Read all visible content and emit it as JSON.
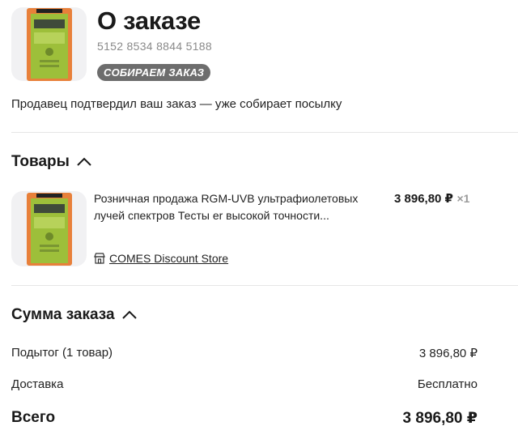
{
  "header": {
    "title": "О заказе",
    "order_number": "5152 8534 8844 5188",
    "status_badge": "СОБИРАЕМ ЗАКАЗ",
    "status_message": "Продавец подтвердил ваш заказ — уже собирает посылку"
  },
  "items_section": {
    "title": "Товары",
    "item": {
      "name_line1": "Розничная продажа RGM-UVB ультрафиолетовых",
      "name_line2": "лучей спектров Тесты er высокой точности...",
      "price": "3 896,80 ₽",
      "quantity": "×1",
      "store": "COMES Discount Store",
      "store_icon": "store-icon"
    }
  },
  "summary_section": {
    "title": "Сумма заказа",
    "subtotal_label": "Подытог (1 товар)",
    "subtotal_value": "3 896,80 ₽",
    "delivery_label": "Доставка",
    "delivery_value": "Бесплатно",
    "total_label": "Всего",
    "total_value": "3 896,80 ₽"
  },
  "colors": {
    "badge_bg": "#6d6d6d",
    "device_orange": "#e8803a",
    "device_green": "#9dbf3a"
  }
}
